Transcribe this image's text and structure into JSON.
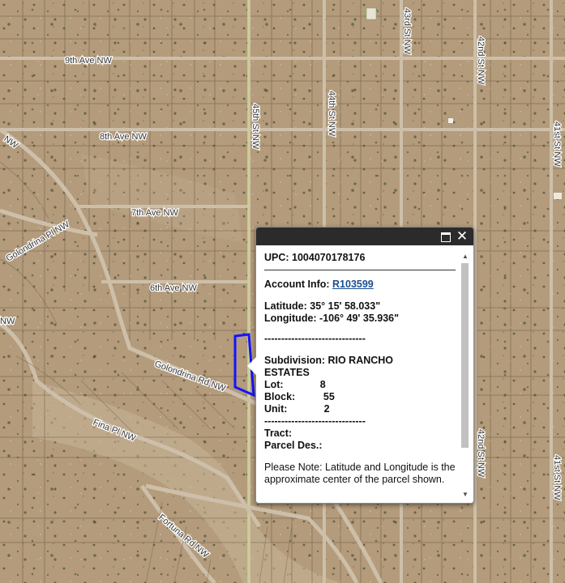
{
  "map": {
    "streets": {
      "ave9": "9th Ave NW",
      "ave8": "8th Ave NW",
      "ave7": "7th Ave NW",
      "ave6": "6th Ave NW",
      "golondrina_pl": "Golondrina Pl NW",
      "golondrina_rd": "Golondrina Rd NW",
      "fina_pl": "Fina Pl NW",
      "fortuna_rd": "Fortuna Rd NW",
      "st45": "45th St NW",
      "st44": "44th St NW",
      "st43": "43rd St NW",
      "st42": "42nd St NW",
      "st42b": "42nd St NW",
      "st41": "41st St NW",
      "st41b": "41st St NW",
      "cut_left_top": "NW",
      "cut_left_mid": "NW"
    },
    "parcel_color": "#1414ff"
  },
  "popup": {
    "upc": "UPC: 1004070178176",
    "account_label": "Account Info: ",
    "account_link": "R103599",
    "latitude": "Latitude: 35° 15' 58.033\"",
    "longitude": "Longitude: -106° 49' 35.936\"",
    "divider": "------------------------------",
    "subdivision_label": "Subdivision: RIO RANCHO",
    "subdivision_cont": "ESTATES",
    "lot": "Lot:             8",
    "block": "Block:          55",
    "unit": "Unit:             2",
    "divider2": "------------------------------",
    "tract": "Tract:",
    "parcel_des": "Parcel Des.:",
    "note": "Please Note: Latitude and Longitude is the approximate center of the parcel shown."
  }
}
